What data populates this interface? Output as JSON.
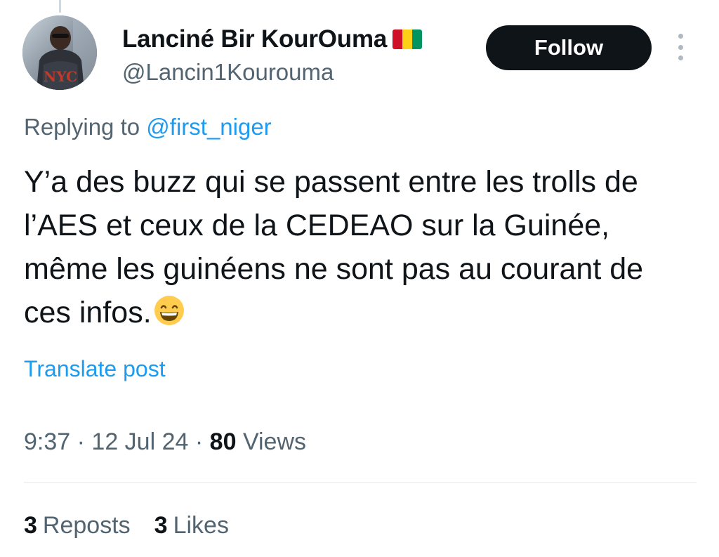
{
  "author": {
    "display_name": "Lanciné Bir KourOuma",
    "handle": "@Lancin1Kourouma",
    "avatar_text": "NYC",
    "flag_colors": [
      "#ce1126",
      "#fcd116",
      "#009460"
    ]
  },
  "actions": {
    "follow_label": "Follow",
    "more_icon": "more-vertical-icon"
  },
  "reply": {
    "prefix": "Replying to",
    "mention": "@first_niger"
  },
  "tweet": {
    "text": "Y’a des buzz qui se passent entre les trolls de l’AES et ceux de la CEDEAO sur la Guinée, même les guinéens ne sont pas au courant de ces infos.",
    "emoji": "grinning-face-with-smiling-eyes"
  },
  "translate_label": "Translate post",
  "meta": {
    "time": "9:37",
    "date": "12 Jul 24",
    "separator": "·",
    "views_count": "80",
    "views_label": "Views"
  },
  "stats": {
    "reposts_count": "3",
    "reposts_label": "Reposts",
    "likes_count": "3",
    "likes_label": "Likes"
  },
  "colors": {
    "accent": "#1d9bf0",
    "text_primary": "#0f1419",
    "text_secondary": "#536471",
    "button_bg": "#0f1419"
  }
}
